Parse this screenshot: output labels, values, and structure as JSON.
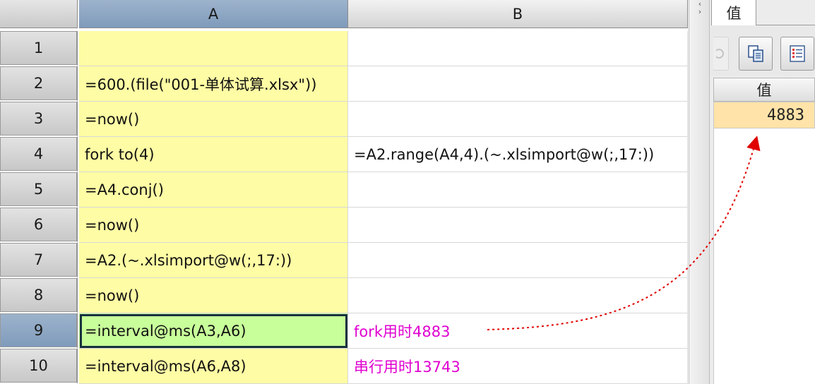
{
  "grid": {
    "columns": [
      "A",
      "B"
    ],
    "rows": [
      {
        "num": "1",
        "a": "",
        "b": ""
      },
      {
        "num": "2",
        "a": "=600.(file(\"001-单体试算.xlsx\"))",
        "b": ""
      },
      {
        "num": "3",
        "a": "=now()",
        "b": ""
      },
      {
        "num": "4",
        "a": "fork to(4)",
        "b": "=A2.range(A4,4).(~.xlsimport@w(;,17:))"
      },
      {
        "num": "5",
        "a": "=A4.conj()",
        "b": ""
      },
      {
        "num": "6",
        "a": "=now()",
        "b": ""
      },
      {
        "num": "7",
        "a": "=A2.(~.xlsimport@w(;,17:))",
        "b": ""
      },
      {
        "num": "8",
        "a": "=now()",
        "b": ""
      },
      {
        "num": "9",
        "a": "=interval@ms(A3,A6)",
        "b": "fork用时4883"
      },
      {
        "num": "10",
        "a": "=interval@ms(A6,A8)",
        "b": "串行用时13743"
      }
    ],
    "selected_row": "9",
    "selected_column": "A"
  },
  "panel": {
    "tab_label": "值",
    "value_header": "值",
    "value": "4883",
    "toolbar_icons": [
      "clear-icon",
      "copy-icon",
      "list-icon"
    ]
  },
  "colors": {
    "formula_cell_bg": "#fefca4",
    "active_cell_bg": "#c8ff9a",
    "note_text": "#e000d0",
    "value_cell_bg": "#ffe3a8",
    "arrow": "#e00000",
    "selected_header": "#8da7c4"
  }
}
